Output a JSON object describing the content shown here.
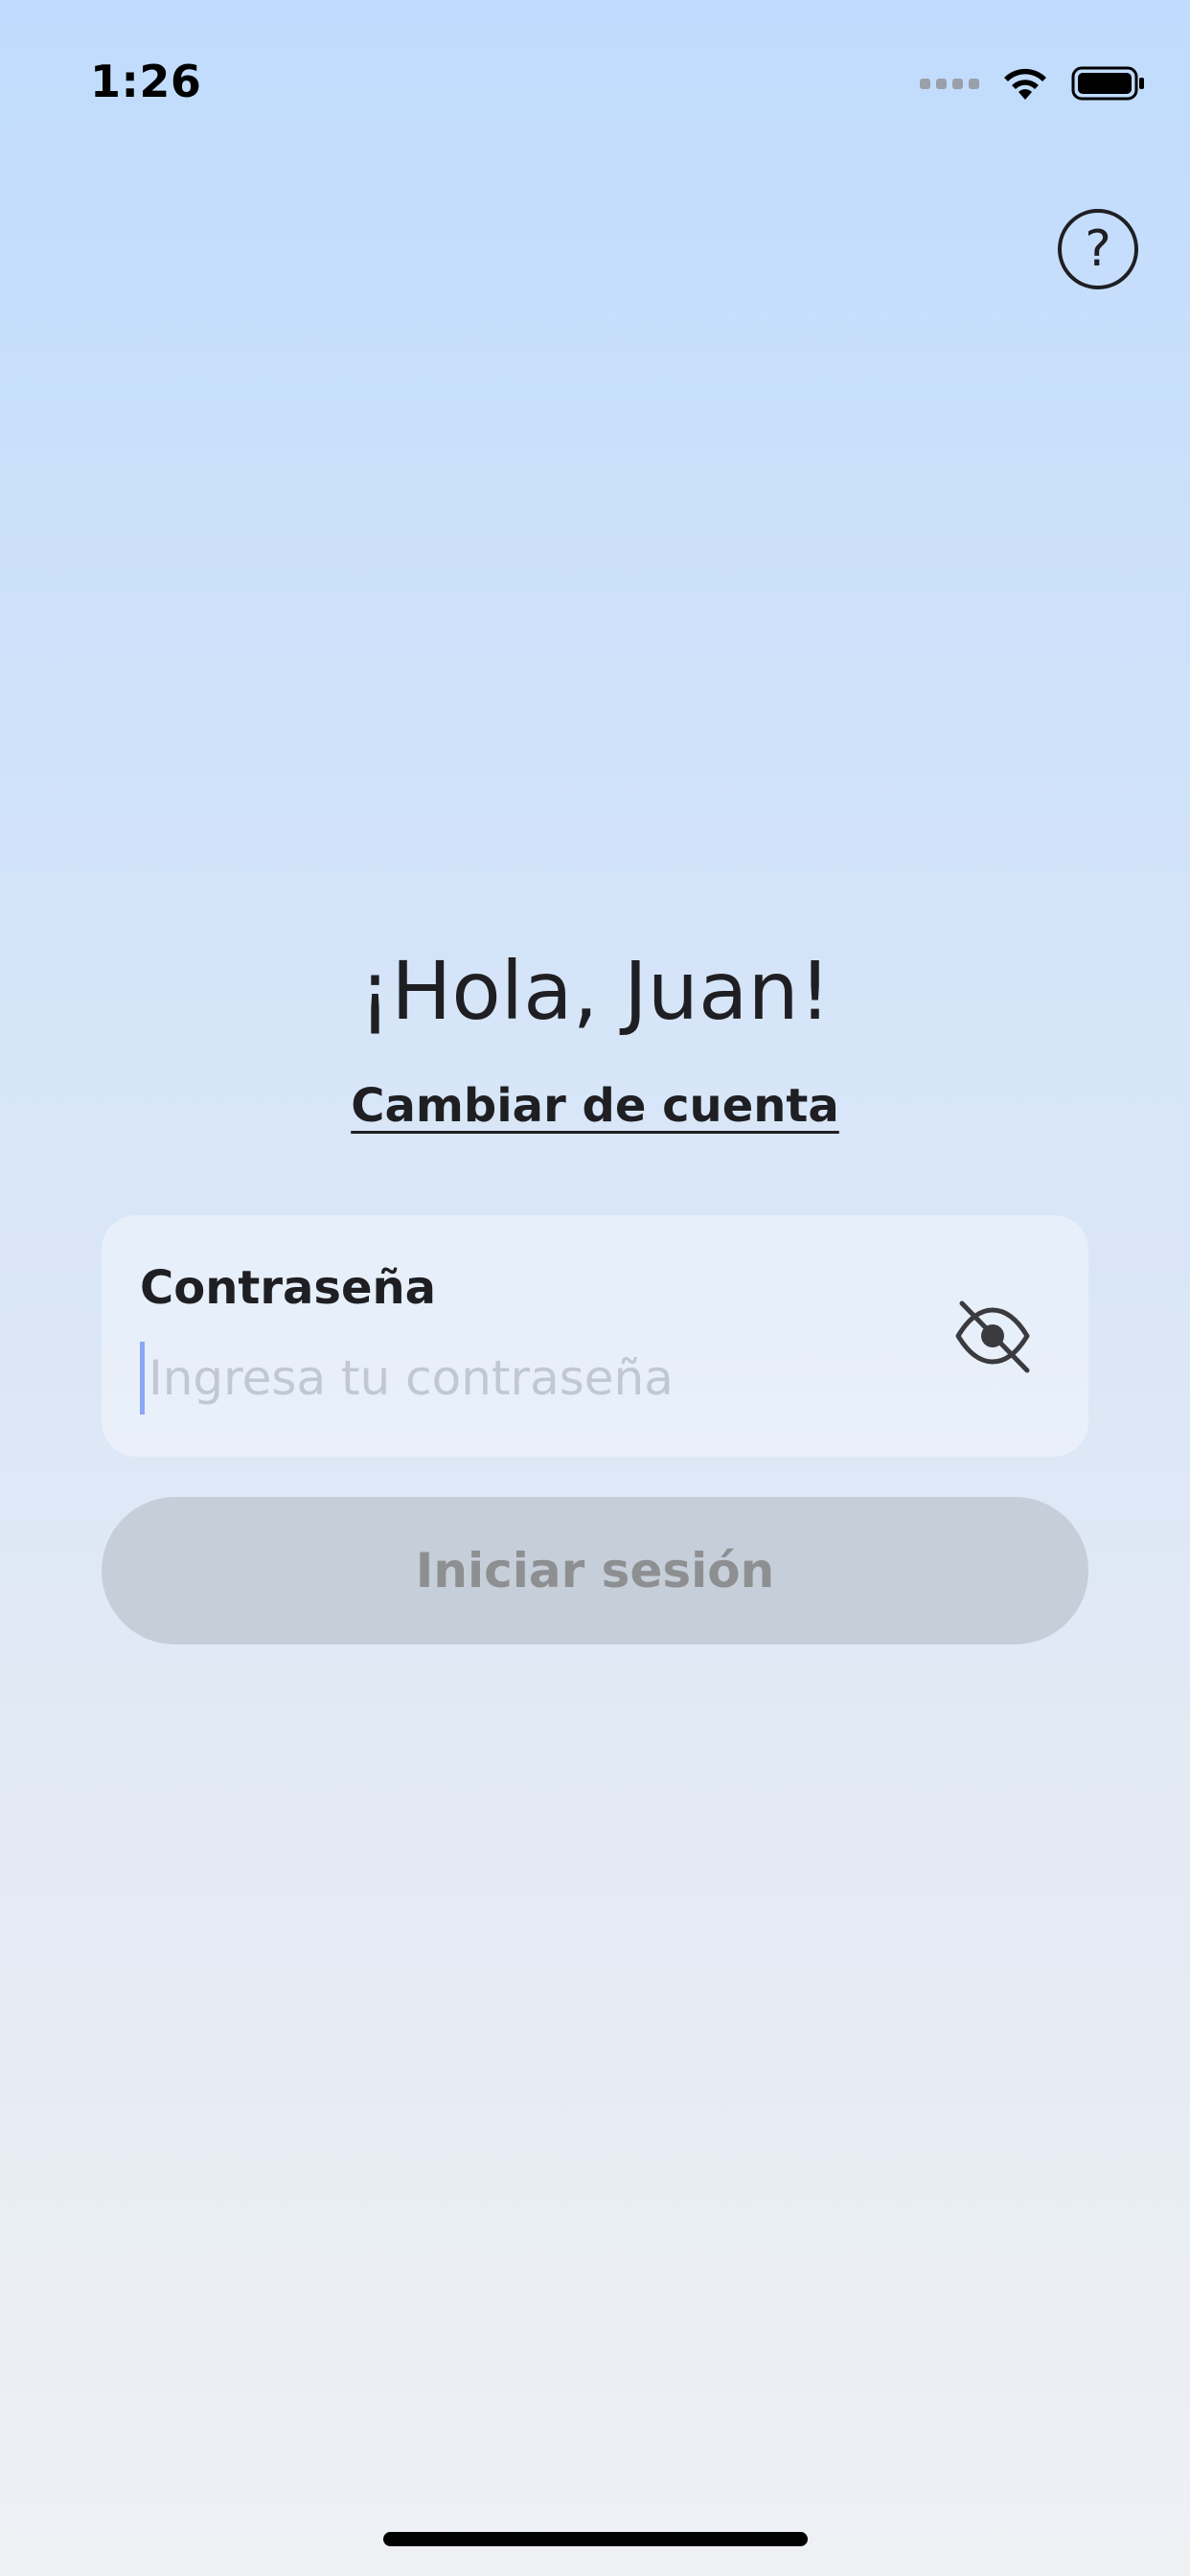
{
  "status_bar": {
    "time": "1:26",
    "signal_icon": "signal-dots-icon",
    "wifi_icon": "wifi-icon",
    "battery_icon": "battery-icon"
  },
  "header": {
    "help_icon": "question-mark-icon",
    "help_glyph": "?"
  },
  "greeting": {
    "title": "¡Hola, Juan!",
    "switch_account": "Cambiar de cuenta"
  },
  "password": {
    "label": "Contraseña",
    "placeholder": "Ingresa tu contraseña",
    "value": "",
    "toggle_icon": "eye-off-icon"
  },
  "login": {
    "label": "Iniciar sesión"
  },
  "colors": {
    "background_top": "#c0dbfd",
    "background_bottom": "#eef0f4",
    "text": "#1f1f23",
    "button_disabled_bg": "#c6ceda",
    "button_disabled_text": "#8e8f91",
    "caret": "#8aa8f5"
  }
}
